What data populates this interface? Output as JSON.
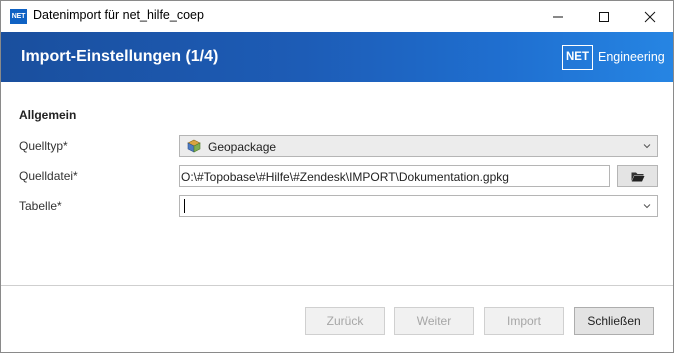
{
  "window": {
    "app_icon": "NET",
    "title": "Datenimport für net_hilfe_coep",
    "controls": {
      "minimize_icon": "minimize-icon",
      "maximize_icon": "maximize-icon",
      "close_icon": "close-icon"
    }
  },
  "header": {
    "title": "Import-Einstellungen (1/4)",
    "brand_box": "NET",
    "brand_text": "Engineering",
    "colors": {
      "start": "#1a4f9e",
      "end": "#2685e3"
    }
  },
  "form": {
    "section_title": "Allgemein",
    "source_type": {
      "label": "Quelltyp*",
      "value": "Geopackage",
      "icon": "geopackage-icon"
    },
    "source_file": {
      "label": "Quelldatei*",
      "value": "O:\\#Topobase\\#Hilfe\\#Zendesk\\IMPORT\\Dokumentation.gpkg",
      "browse_icon": "folder-open-icon"
    },
    "table": {
      "label": "Tabelle*",
      "value": ""
    }
  },
  "footer": {
    "back_label": "Zurück",
    "next_label": "Weiter",
    "import_label": "Import",
    "close_label": "Schließen"
  }
}
